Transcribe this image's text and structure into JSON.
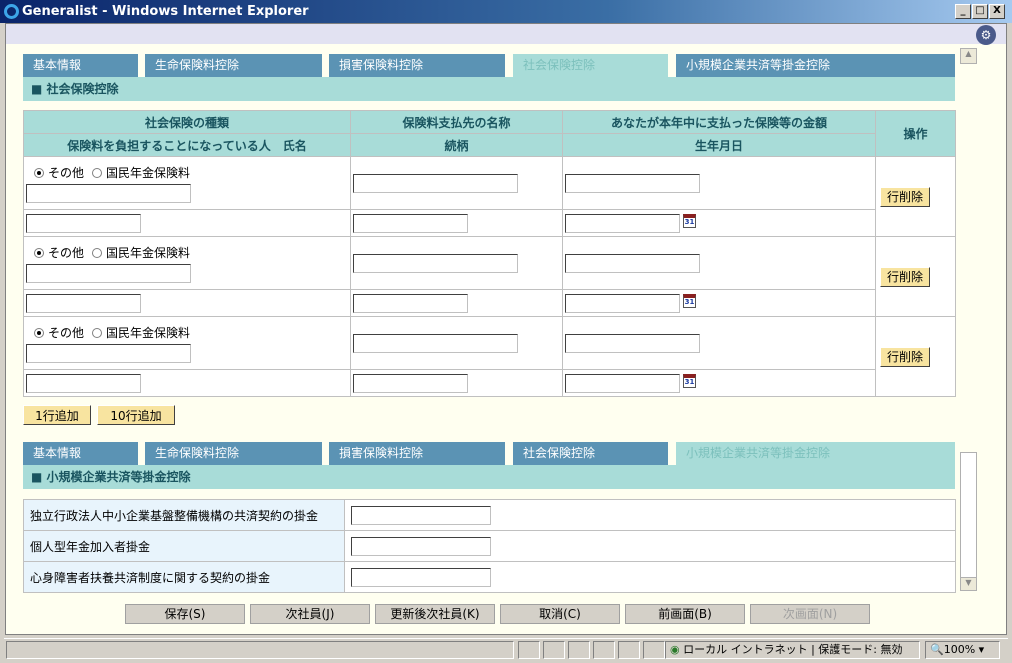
{
  "window": {
    "title": "Generalist - Windows Internet Explorer",
    "min": "_",
    "max": "□",
    "close": "X"
  },
  "tabs": [
    "基本情報",
    "生命保険料控除",
    "損害保険料控除",
    "社会保険控除",
    "小規模企業共済等掛金控除"
  ],
  "social": {
    "section_title": "■ 社会保険控除",
    "headers": {
      "type": "社会保険の種類",
      "payee": "保険料支払先の名称",
      "amount": "あなたが本年中に支払った保険等の金額",
      "op": "操作",
      "person": "保険料を負担することになっている人　氏名",
      "relation": "続柄",
      "birth": "生年月日"
    },
    "radio_other": "その他",
    "radio_national": "国民年金保険料",
    "delete_label": "行削除",
    "calendar_label": "31",
    "add1": "1行追加",
    "add10": "10行追加"
  },
  "small": {
    "section_title": "■ 小規模企業共済等掛金控除",
    "rows": [
      "独立行政法人中小企業基盤整備機構の共済契約の掛金",
      "個人型年金加入者掛金",
      "心身障害者扶養共済制度に関する契約の掛金"
    ]
  },
  "buttons": {
    "save": "保存(S)",
    "next_emp": "次社員(J)",
    "update_next": "更新後次社員(K)",
    "cancel": "取消(C)",
    "prev": "前画面(B)",
    "next": "次画面(N)"
  },
  "status": {
    "zone": "ローカル イントラネット | 保護モード: 無効",
    "zoom": "100%"
  }
}
